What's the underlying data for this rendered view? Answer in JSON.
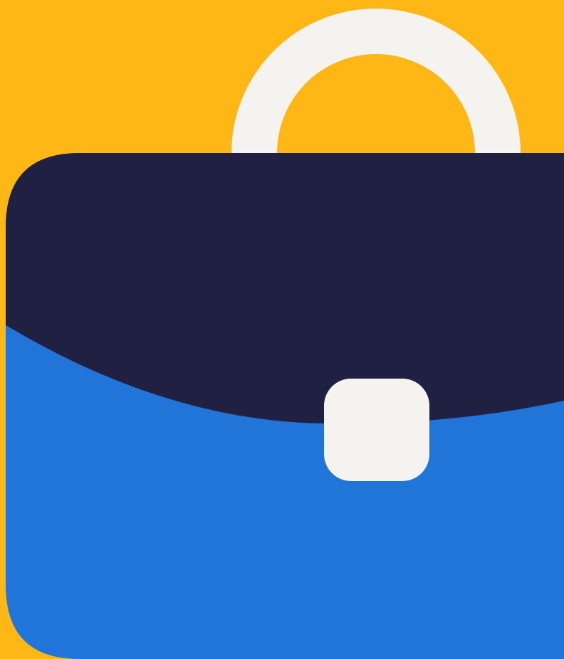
{
  "illustration": {
    "icon": "briefcase-icon",
    "colors": {
      "background": "#FEB715",
      "handle": "#F4F3EF",
      "flap": "#1F2042",
      "body": "#2175D8",
      "clasp": "#F4F3EF"
    }
  }
}
